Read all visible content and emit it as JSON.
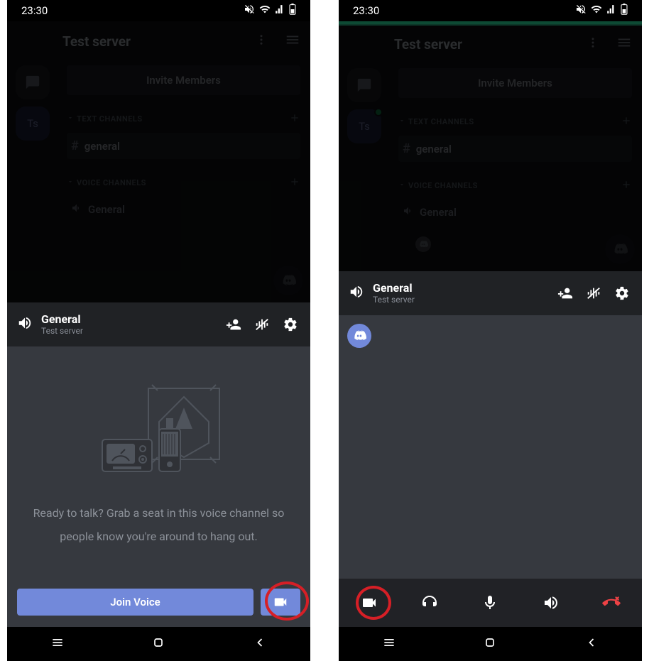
{
  "status": {
    "time": "23:30"
  },
  "server": {
    "name": "Test server",
    "badge": "Ts",
    "invite_label": "Invite Members",
    "sections": {
      "text": {
        "header": "TEXT CHANNELS",
        "items": [
          {
            "name": "general"
          }
        ]
      },
      "voice": {
        "header": "VOICE CHANNELS",
        "items": [
          {
            "name": "General"
          }
        ]
      }
    }
  },
  "voicebar": {
    "channel": "General",
    "server": "Test server"
  },
  "panel_left": {
    "prompt_line1": "Ready to talk? Grab a seat in this voice channel so",
    "prompt_line2": "people know you're around to hang out.",
    "join_label": "Join Voice"
  }
}
